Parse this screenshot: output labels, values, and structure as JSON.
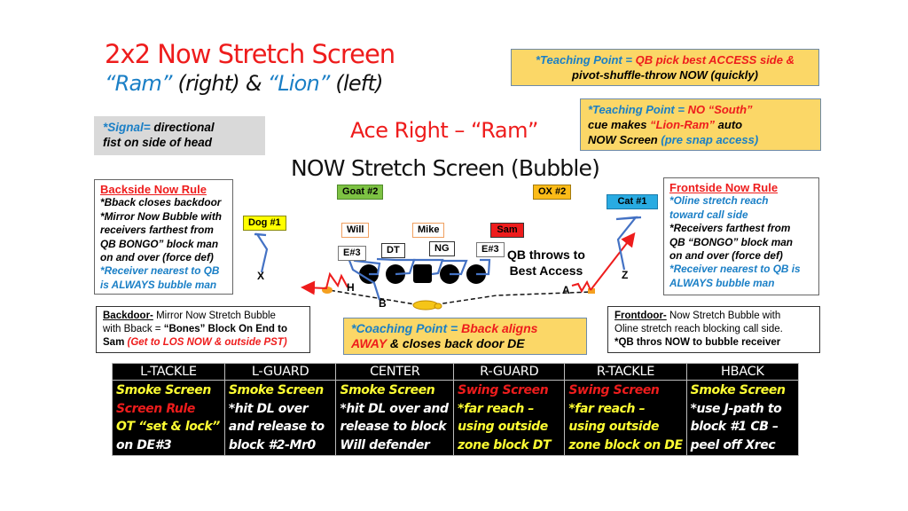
{
  "title": {
    "main": "2x2 Now Stretch Screen",
    "sub_ram": "“Ram”",
    "sub_right": " (right) & ",
    "sub_lion": "“Lion”",
    "sub_left": " (left)"
  },
  "teaching_point_1": {
    "label": "*Teaching Point = ",
    "red": "QB pick best ACCESS side & ",
    "black": "pivot-shuffle-throw NOW (quickly)"
  },
  "teaching_point_2": {
    "label": "*Teaching Point = ",
    "red1": "NO “South”",
    "black1": "cue makes ",
    "red2": "“Lion-Ram”",
    "black2": " auto",
    "black3": "NOW Screen ",
    "blue": "(pre snap access)"
  },
  "signal": {
    "label": "*Signal= ",
    "text1": "directional",
    "text2": "fist on side of head"
  },
  "formation": "Ace Right – “Ram”",
  "play_name": "NOW Stretch Screen (Bubble)",
  "backside_rule": {
    "header": "Backside Now Rule",
    "lines_black": [
      "*Bback closes backdoor",
      "*Mirror Now Bubble with",
      "receivers farthest from",
      "QB BONGO” block man",
      "on and over (force def)"
    ],
    "lines_blue": [
      "*Receiver nearest to QB",
      "is ALWAYS bubble man"
    ]
  },
  "frontside_rule": {
    "header": "Frontside Now Rule",
    "lines_blue1": [
      "*Oline stretch reach",
      "toward call side"
    ],
    "lines_black": [
      "*Receivers farthest from",
      "QB “BONGO” block man",
      "on and over (force def)"
    ],
    "lines_blue2": [
      "*Receiver nearest to QB is",
      "ALWAYS bubble man"
    ]
  },
  "backdoor": {
    "label": "Backdoor-",
    "text1": " Mirror Now Stretch Bubble",
    "text2": "with Bback = ",
    "bold": "“Bones” Block On End to",
    "text3": "Sam ",
    "red": "(Get to LOS NOW & outside PST)"
  },
  "frontdoor": {
    "label": "Frontdoor-",
    "text1": " Now Stretch Bubble  with",
    "text2": "Oline stretch reach blocking call side.",
    "bold": "*QB thros NOW to bubble receiver"
  },
  "coaching_point": {
    "label": "*Coaching Point = ",
    "red1": "Bback aligns",
    "red2": "AWAY",
    "black": " & closes back door DE"
  },
  "defenders": {
    "goat": "Goat #2",
    "ox": "OX #2",
    "cat": "Cat #1",
    "dog": "Dog #1",
    "will": "Will",
    "mike": "Mike",
    "sam": "Sam",
    "e3_left": "E#3",
    "dt": "DT",
    "ng": "NG",
    "e3_right": "E#3"
  },
  "players": {
    "x": "X",
    "h": "H",
    "b": "B",
    "a": "A",
    "z": "Z"
  },
  "throw_label": [
    "QB throws to",
    "Best Access"
  ],
  "colors": {
    "goat": "#7dc243",
    "ox": "#fbbb18",
    "cat": "#29abe2",
    "dog": "#ffff00",
    "sam": "#ee1c1c",
    "linebacker_border": "#f0a060",
    "route": "#4472c4",
    "throw": "#ee1c1c"
  },
  "assignments": {
    "headers": [
      "L-TACKLE",
      "L-GUARD",
      "CENTER",
      "R-GUARD",
      "R-TACKLE",
      "HBACK"
    ],
    "columns": [
      [
        {
          "t": "Smoke Screen",
          "c": "yellow"
        },
        {
          "t": "Screen Rule",
          "c": "red"
        },
        {
          "t": "OT “set & lock”",
          "c": "yellow"
        },
        {
          "t": "on DE#3",
          "c": "white"
        }
      ],
      [
        {
          "t": "Smoke Screen",
          "c": "yellow"
        },
        {
          "t": "*hit DL over",
          "c": "white"
        },
        {
          "t": "and release to",
          "c": "white"
        },
        {
          "t": "block #2-Mr0",
          "c": "white"
        }
      ],
      [
        {
          "t": "Smoke Screen",
          "c": "yellow"
        },
        {
          "t": "*hit DL over and",
          "c": "white"
        },
        {
          "t": "release to block",
          "c": "white"
        },
        {
          "t": "Will defender",
          "c": "white"
        }
      ],
      [
        {
          "t": "Swing Screen",
          "c": "red"
        },
        {
          "t": "*far reach –",
          "c": "yellow"
        },
        {
          "t": "using outside",
          "c": "yellow"
        },
        {
          "t": "zone block DT",
          "c": "yellow"
        }
      ],
      [
        {
          "t": "Swing Screen",
          "c": "red"
        },
        {
          "t": "*far reach –",
          "c": "yellow"
        },
        {
          "t": "using outside",
          "c": "yellow"
        },
        {
          "t": "zone block on DE",
          "c": "yellow"
        }
      ],
      [
        {
          "t": "Smoke Screen",
          "c": "yellow"
        },
        {
          "t": "*use J-path to",
          "c": "white"
        },
        {
          "t": "block #1 CB –",
          "c": "white"
        },
        {
          "t": "peel off Xrec",
          "c": "white"
        }
      ]
    ]
  }
}
